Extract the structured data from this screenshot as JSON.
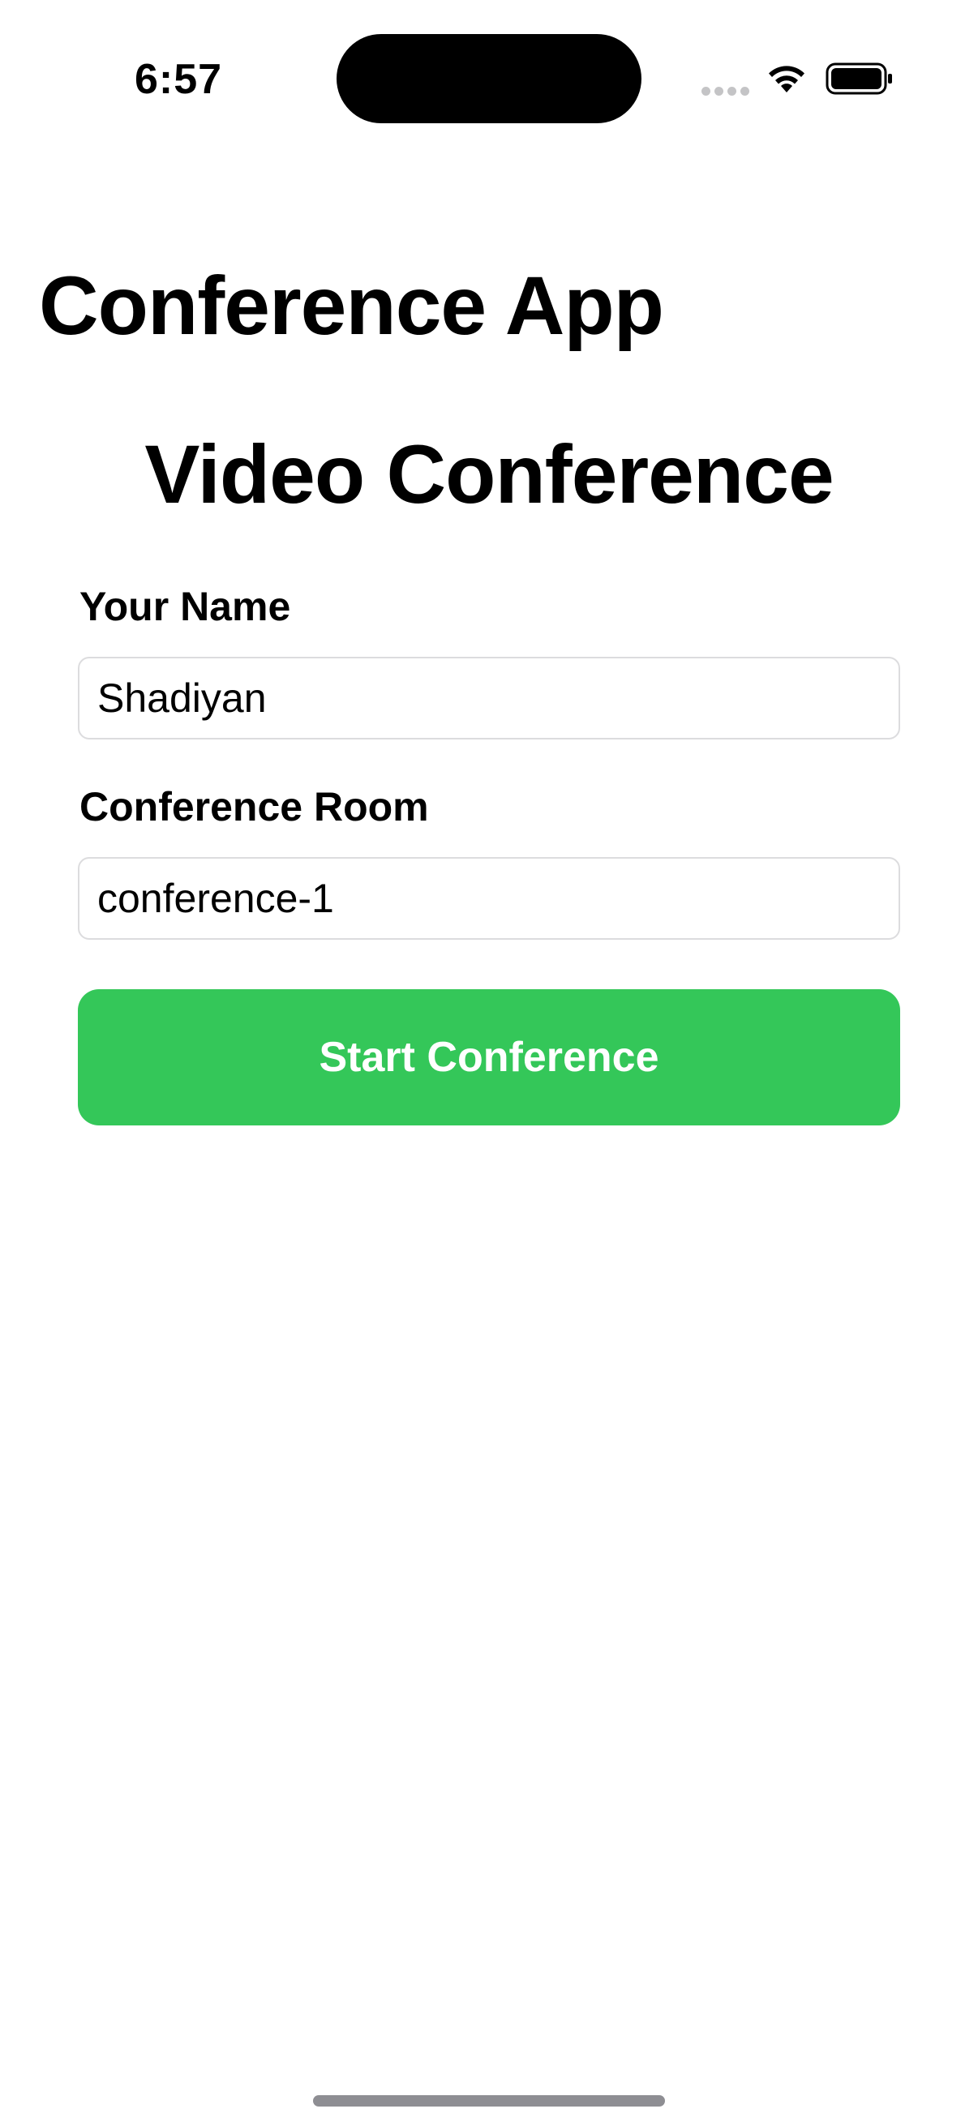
{
  "status_bar": {
    "time": "6:57",
    "icons": [
      "signal-dots-icon",
      "wifi-icon",
      "battery-icon"
    ]
  },
  "nav": {
    "title": "Conference App"
  },
  "main": {
    "heading": "Video Conference",
    "name_field": {
      "label": "Your Name",
      "value": "Shadiyan"
    },
    "room_field": {
      "label": "Conference Room",
      "value": "conference-1"
    },
    "start_button": {
      "label": "Start Conference"
    }
  },
  "colors": {
    "accent": "#34c759",
    "field_border": "#dcdcde",
    "background": "#ffffff"
  }
}
